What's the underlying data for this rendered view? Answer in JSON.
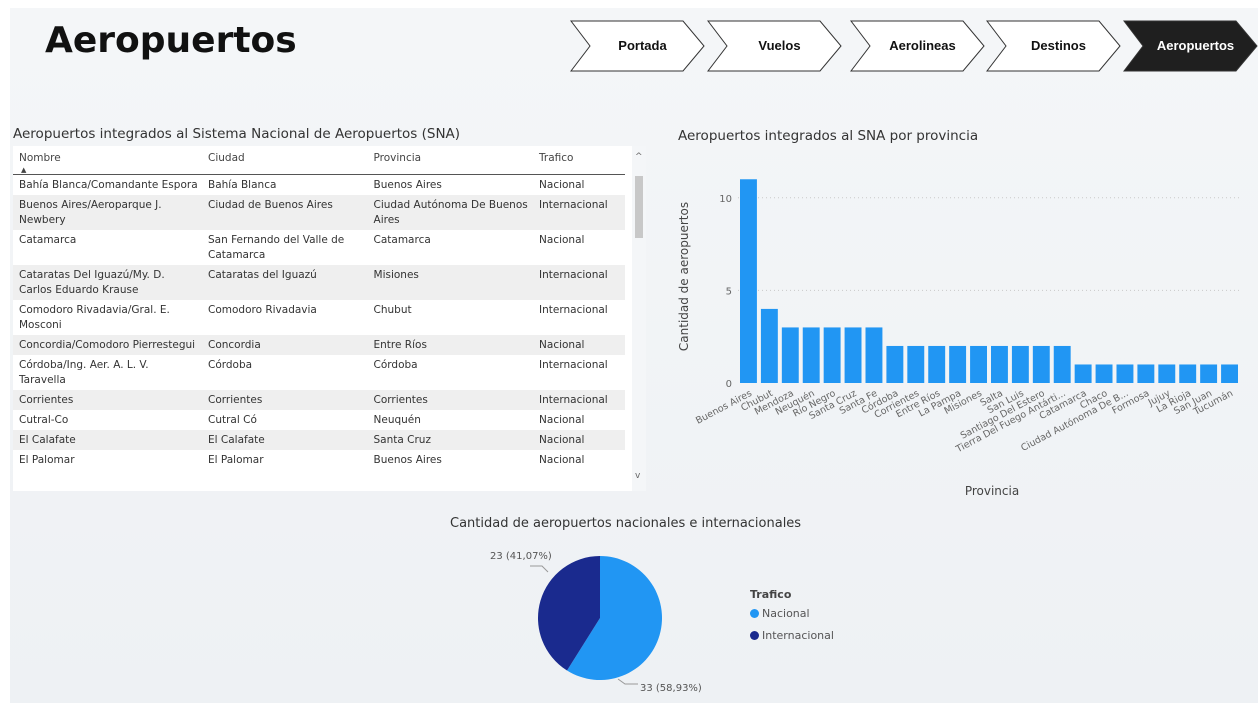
{
  "page": {
    "title": "Aeropuertos"
  },
  "nav": {
    "buttons": [
      {
        "label": "Portada",
        "active": false
      },
      {
        "label": "Vuelos",
        "active": false
      },
      {
        "label": "Aerolineas",
        "active": false
      },
      {
        "label": "Destinos",
        "active": false
      },
      {
        "label": "Aeropuertos",
        "active": true
      }
    ]
  },
  "table": {
    "title": "Aeropuertos integrados al Sistema Nacional de Aeropuertos (SNA)",
    "columns": [
      "Nombre",
      "Ciudad",
      "Provincia",
      "Trafico"
    ],
    "rows": [
      [
        "Bahía Blanca/Comandante Espora",
        "Bahía Blanca",
        "Buenos Aires",
        "Nacional"
      ],
      [
        "Buenos Aires/Aeroparque J. Newbery",
        "Ciudad de Buenos Aires",
        "Ciudad Autónoma De Buenos Aires",
        "Internacional"
      ],
      [
        "Catamarca",
        "San Fernando del Valle de Catamarca",
        "Catamarca",
        "Nacional"
      ],
      [
        "Cataratas Del Iguazú/My. D. Carlos Eduardo Krause",
        "Cataratas del Iguazú",
        "Misiones",
        "Internacional"
      ],
      [
        "Comodoro Rivadavia/Gral. E. Mosconi",
        "Comodoro Rivadavia",
        "Chubut",
        "Internacional"
      ],
      [
        "Concordia/Comodoro Pierrestegui",
        "Concordia",
        "Entre Ríos",
        "Nacional"
      ],
      [
        "Córdoba/Ing. Aer. A. L. V. Taravella",
        "Córdoba",
        "Córdoba",
        "Internacional"
      ],
      [
        "Corrientes",
        "Corrientes",
        "Corrientes",
        "Internacional"
      ],
      [
        "Cutral-Co",
        "Cutral Có",
        "Neuquén",
        "Nacional"
      ],
      [
        "El Calafate",
        "El Calafate",
        "Santa Cruz",
        "Nacional"
      ],
      [
        "El Palomar",
        "El Palomar",
        "Buenos Aires",
        "Nacional"
      ]
    ]
  },
  "chart_data": [
    {
      "type": "bar",
      "title": "Aeropuertos integrados al SNA por provincia",
      "xlabel": "Provincia",
      "ylabel": "Cantidad de aeropuertos",
      "ylim": [
        0,
        11.5
      ],
      "yticks": [
        0,
        5,
        10
      ],
      "grid": true,
      "color": "#2196f3",
      "categories": [
        "Buenos Aires",
        "Chubut",
        "Mendoza",
        "Neuquén",
        "Río Negro",
        "Santa Cruz",
        "Santa Fe",
        "Córdoba",
        "Corrientes",
        "Entre Ríos",
        "La Pampa",
        "Misiones",
        "Salta",
        "San Luis",
        "Santiago Del Estero",
        "Tierra Del Fuego Antárti...",
        "Catamarca",
        "Chaco",
        "Ciudad Autónoma De B...",
        "Formosa",
        "Jujuy",
        "La Rioja",
        "San Juan",
        "Tucumán"
      ],
      "values": [
        11,
        4,
        3,
        3,
        3,
        3,
        3,
        2,
        2,
        2,
        2,
        2,
        2,
        2,
        2,
        2,
        1,
        1,
        1,
        1,
        1,
        1,
        1,
        1
      ]
    },
    {
      "type": "pie",
      "title": "Cantidad de aeropuertos nacionales e internacionales",
      "legend_title": "Trafico",
      "slices": [
        {
          "name": "Nacional",
          "value": 33,
          "label": "33 (58,93%)",
          "color": "#2196f3"
        },
        {
          "name": "Internacional",
          "value": 23,
          "label": "23 (41,07%)",
          "color": "#1a2a8e"
        }
      ]
    }
  ]
}
